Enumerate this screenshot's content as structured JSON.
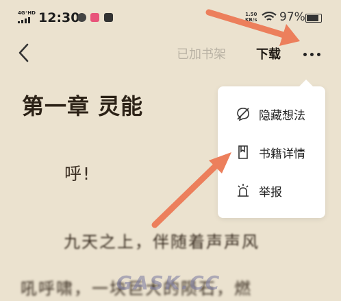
{
  "status_bar": {
    "network": "4G⁺HD",
    "time": "12:30",
    "speed_top": "1.50",
    "speed_unit": "KB/s",
    "battery": "97%"
  },
  "nav": {
    "shelf_label": "已加书架",
    "download_label": "下载"
  },
  "content": {
    "chapter_title": "第一章 灵能",
    "paragraphs": [
      "呼!",
      "九天之上，伴随着声声风",
      "吼呼啸，一块巨大的陨石，燃"
    ]
  },
  "menu": {
    "items": [
      {
        "label": "隐藏想法",
        "icon": "hide-thoughts-icon"
      },
      {
        "label": "书籍详情",
        "icon": "book-details-icon"
      },
      {
        "label": "举报",
        "icon": "report-alarm-icon"
      }
    ]
  },
  "watermark": "GASK.CC",
  "colors": {
    "background": "#ebe2cf",
    "arrow": "#ec7f5c",
    "menu_bg": "#ffffff"
  }
}
